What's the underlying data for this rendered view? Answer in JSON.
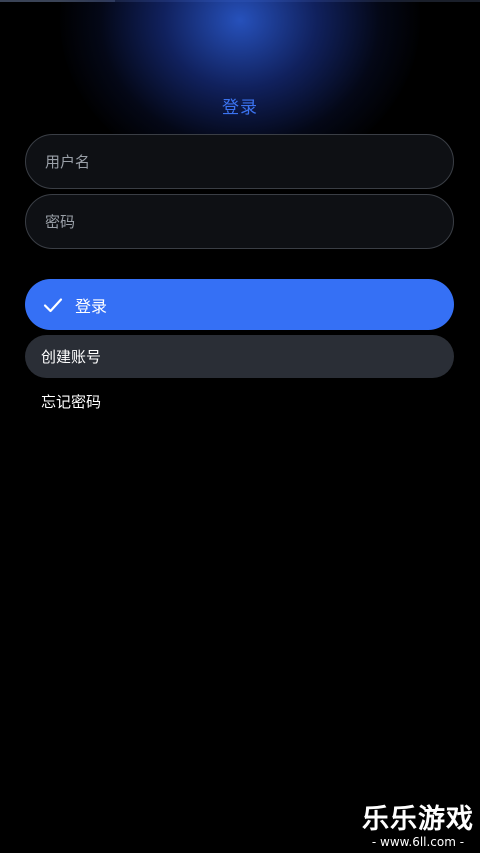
{
  "header": {
    "title": "登录"
  },
  "form": {
    "username_placeholder": "用户名",
    "password_placeholder": "密码",
    "login_label": "登录",
    "create_account_label": "创建账号",
    "forgot_password_label": "忘记密码"
  },
  "icons": {
    "login": "check-icon"
  },
  "watermark": {
    "main": "乐乐游戏",
    "sub": "- www.6ll.com -"
  },
  "colors": {
    "accent": "#3570f5",
    "title": "#3b73f0",
    "secondary_button": "#2a2e36",
    "background": "#000000"
  }
}
